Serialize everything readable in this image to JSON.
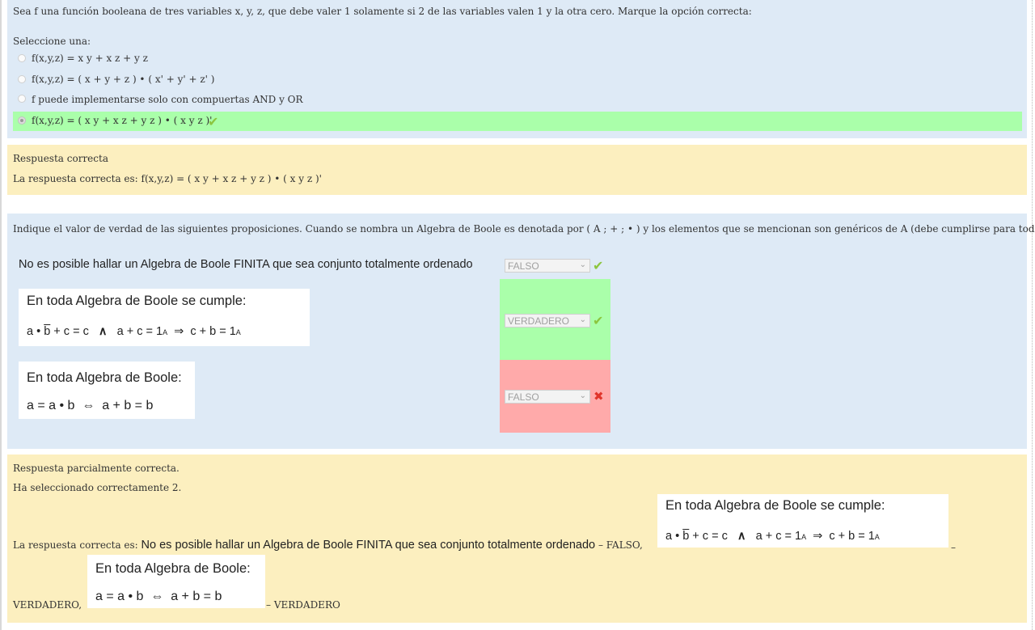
{
  "q1": {
    "question": "Sea f una función booleana de tres variables x, y, z, que debe valer 1 solamente si 2 de las variables valen 1 y la otra cero. Marque la opción correcta:",
    "prompt": "Seleccione una:",
    "options": [
      "f(x,y,z) = x y + x z + y z",
      "f(x,y,z) = ( x + y + z ) • ( x' + y' + z' )",
      "f puede implementarse solo con compuertas AND y OR",
      "f(x,y,z)  = ( x y + x z + y z ) • ( x y z )'"
    ],
    "selected_index": 3,
    "feedback_title": "Respuesta correcta",
    "feedback_text": "La respuesta correcta es: f(x,y,z)  = ( x y + x z + y z ) • ( x y z )'"
  },
  "q2": {
    "question": "Indique el valor de verdad de las siguientes proposiciones. Cuando se nombra un Algebra de Boole es denotada por ( A ; + ; • ) y los elementos que se mencionan son genéricos de A (debe cumplirse para todos)",
    "items": [
      {
        "statement": "No es posible hallar un Algebra de Boole FINITA que sea conjunto totalmente ordenado",
        "answer": "FALSO",
        "result": "correct"
      },
      {
        "title": "En toda Algebra de Boole se cumple:",
        "f1": "a • ",
        "f_b": "b",
        "f2": " + c = c   ",
        "f_and": "∧",
        "f3": "   a + c = 1",
        "f_sub": "A",
        "f4": "  ⇒  c + b = 1",
        "f_sub2": "A",
        "answer": "VERDADERO",
        "result": "correct"
      },
      {
        "title": "En toda Algebra de Boole:",
        "formula": "a = a • b  ⇔  a + b = b",
        "answer": "FALSO",
        "result": "incorrect"
      }
    ],
    "feedback_title": "Respuesta parcialmente correcta.",
    "feedback_count": "Ha seleccionado correctamente 2.",
    "correct_prefix": "La respuesta correcta es: ",
    "correct_stmt1": "No es posible hallar un Algebra de Boole FINITA que sea conjunto totalmente ordenado",
    "sep1": " – FALSO,",
    "sep2": " –",
    "verdadero_prefix": "VERDADERO,",
    "sep3": " – VERDADERO"
  },
  "colors": {
    "question_bg": "#deeaf6",
    "feedback_bg": "#fcefbf",
    "correct_bg": "#aaffaa",
    "incorrect_bg": "#ffaaaa",
    "check": "#8cc63f",
    "cross": "#e0352b"
  }
}
